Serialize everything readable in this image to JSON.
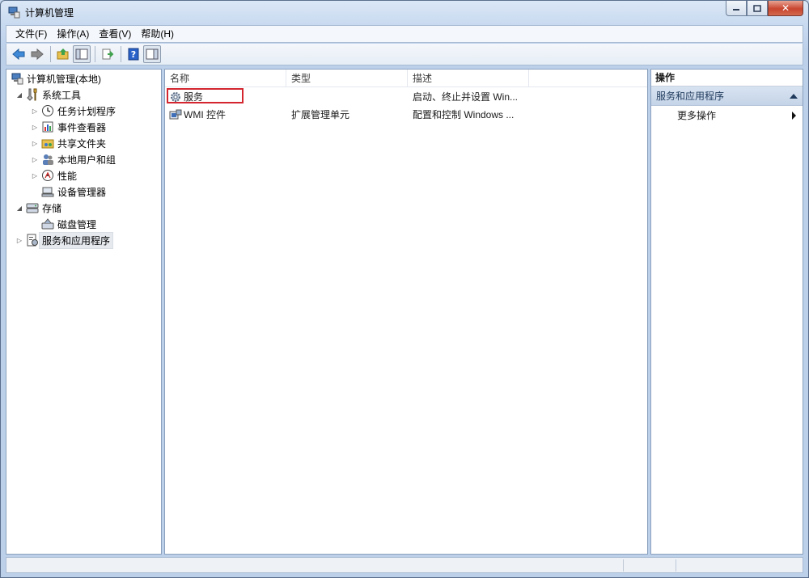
{
  "window": {
    "title": "计算机管理"
  },
  "menu": [
    "文件(F)",
    "操作(A)",
    "查看(V)",
    "帮助(H)"
  ],
  "toolbar": {
    "buttons": [
      "back-icon",
      "forward-icon",
      "up-folder-icon",
      "show-hide-console-tree-icon",
      "export-list-icon",
      "help-icon",
      "show-hide-action-pane-icon"
    ]
  },
  "tree": {
    "root": "计算机管理(本地)",
    "system_tools": "系统工具",
    "task_scheduler": "任务计划程序",
    "event_viewer": "事件查看器",
    "shared_folders": "共享文件夹",
    "local_users": "本地用户和组",
    "performance": "性能",
    "device_manager": "设备管理器",
    "storage": "存储",
    "disk_management": "磁盘管理",
    "services_apps": "服务和应用程序"
  },
  "list": {
    "columns": [
      "名称",
      "类型",
      "描述"
    ],
    "rows": [
      {
        "name": "服务",
        "type": "",
        "desc": "启动、终止并设置 Win..."
      },
      {
        "name": "WMI 控件",
        "type": "扩展管理单元",
        "desc": "配置和控制 Windows ..."
      }
    ]
  },
  "actions": {
    "title": "操作",
    "section": "服务和应用程序",
    "more": "更多操作"
  },
  "colors": {
    "highlight_box": "#d3262f",
    "accent": "#1e395b"
  }
}
